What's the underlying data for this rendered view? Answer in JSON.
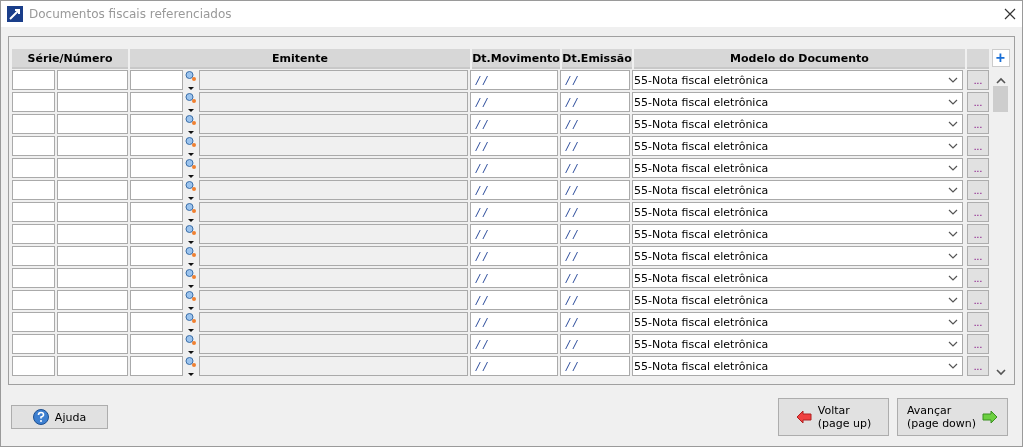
{
  "window": {
    "title": "Documentos fiscais referenciados"
  },
  "table": {
    "columns": [
      "Série/Número",
      "Emitente",
      "Dt.Movimento",
      "Dt.Emissão",
      "Modelo do Documento"
    ],
    "add_button": "+",
    "rows": [
      {
        "dt_movimento": "/ /",
        "dt_emissao": "/ /",
        "modelo": "55-Nota fiscal eletrônica",
        "more": "..."
      },
      {
        "dt_movimento": "/ /",
        "dt_emissao": "/ /",
        "modelo": "55-Nota fiscal eletrônica",
        "more": "..."
      },
      {
        "dt_movimento": "/ /",
        "dt_emissao": "/ /",
        "modelo": "55-Nota fiscal eletrônica",
        "more": "..."
      },
      {
        "dt_movimento": "/ /",
        "dt_emissao": "/ /",
        "modelo": "55-Nota fiscal eletrônica",
        "more": "..."
      },
      {
        "dt_movimento": "/ /",
        "dt_emissao": "/ /",
        "modelo": "55-Nota fiscal eletrônica",
        "more": "..."
      },
      {
        "dt_movimento": "/ /",
        "dt_emissao": "/ /",
        "modelo": "55-Nota fiscal eletrônica",
        "more": "..."
      },
      {
        "dt_movimento": "/ /",
        "dt_emissao": "/ /",
        "modelo": "55-Nota fiscal eletrônica",
        "more": "..."
      },
      {
        "dt_movimento": "/ /",
        "dt_emissao": "/ /",
        "modelo": "55-Nota fiscal eletrônica",
        "more": "..."
      },
      {
        "dt_movimento": "/ /",
        "dt_emissao": "/ /",
        "modelo": "55-Nota fiscal eletrônica",
        "more": "..."
      },
      {
        "dt_movimento": "/ /",
        "dt_emissao": "/ /",
        "modelo": "55-Nota fiscal eletrônica",
        "more": "..."
      },
      {
        "dt_movimento": "/ /",
        "dt_emissao": "/ /",
        "modelo": "55-Nota fiscal eletrônica",
        "more": "..."
      },
      {
        "dt_movimento": "/ /",
        "dt_emissao": "/ /",
        "modelo": "55-Nota fiscal eletrônica",
        "more": "..."
      },
      {
        "dt_movimento": "/ /",
        "dt_emissao": "/ /",
        "modelo": "55-Nota fiscal eletrônica",
        "more": "..."
      },
      {
        "dt_movimento": "/ /",
        "dt_emissao": "/ /",
        "modelo": "55-Nota fiscal eletrônica",
        "more": "..."
      }
    ]
  },
  "buttons": [
    {
      "kind": "help",
      "label": "Ajuda"
    },
    {
      "kind": "back",
      "label": "Voltar",
      "sub": "(page up)"
    },
    {
      "kind": "forward",
      "label": "Avançar",
      "sub": "(page down)"
    }
  ]
}
